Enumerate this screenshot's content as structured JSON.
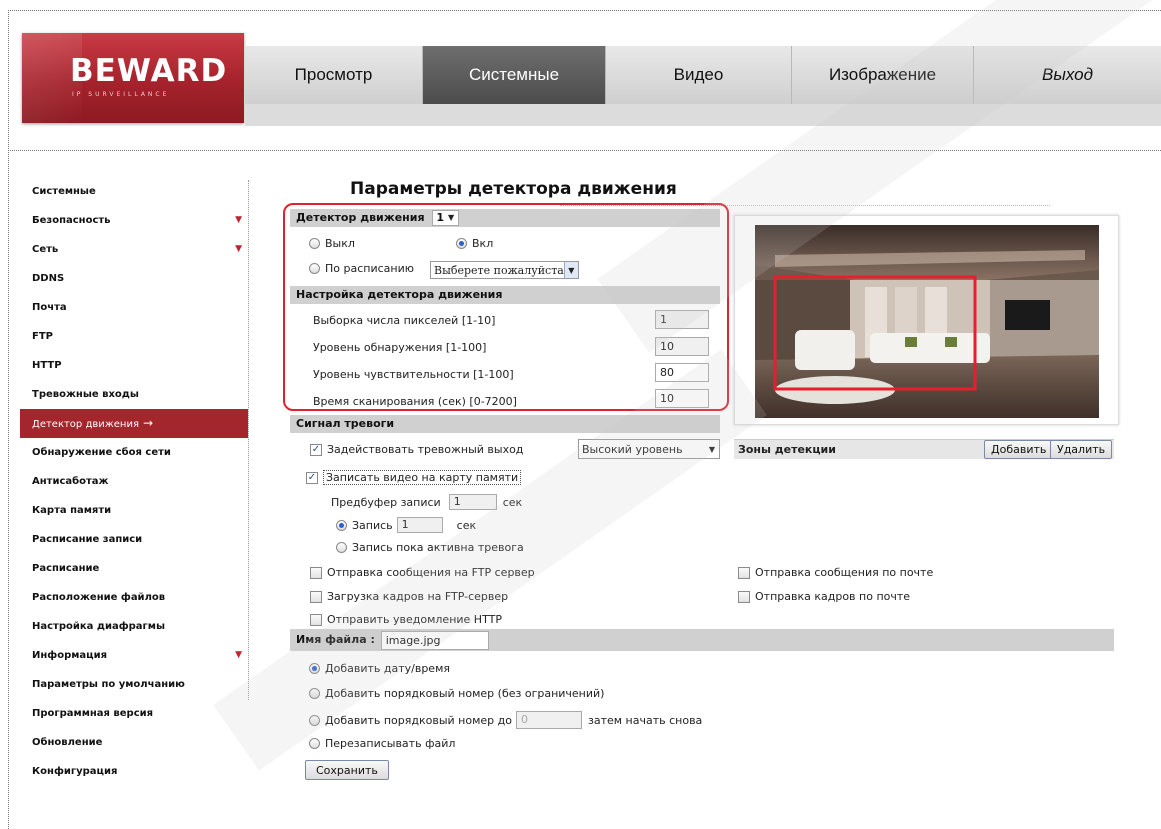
{
  "brand": {
    "logo_text": "BEWARD",
    "logo_sub": "IP SURVEILLANCE"
  },
  "nav": {
    "tabs": [
      "Просмотр",
      "Системные",
      "Видео",
      "Изображение",
      "Выход"
    ],
    "active": "Системные"
  },
  "sidebar": {
    "items": [
      {
        "label": "Системные"
      },
      {
        "label": "Безопасность",
        "arrow": "▼"
      },
      {
        "label": "Сеть",
        "arrow": "▼"
      },
      {
        "label": "DDNS"
      },
      {
        "label": "Почта"
      },
      {
        "label": "FTP"
      },
      {
        "label": "HTTP"
      },
      {
        "label": "Тревожные входы"
      },
      {
        "label": "Детектор движения",
        "arrow": "→",
        "active": true
      },
      {
        "label": "Обнаружение сбоя сети"
      },
      {
        "label": "Антисаботаж"
      },
      {
        "label": "Карта памяти"
      },
      {
        "label": "Расписание записи"
      },
      {
        "label": "Расписание"
      },
      {
        "label": "Расположение файлов"
      },
      {
        "label": "Настройка диафрагмы"
      },
      {
        "label": "Информация",
        "arrow": "▼"
      },
      {
        "label": "Параметры по умолчанию"
      },
      {
        "label": "Программная версия"
      },
      {
        "label": "Обновление"
      },
      {
        "label": "Конфигурация"
      }
    ]
  },
  "page": {
    "title": "Параметры детектора движения"
  },
  "motion": {
    "header": "Детектор движения",
    "channel": "1",
    "off_label": "Выкл",
    "on_label": "Вкл",
    "schedule_label": "По расписанию",
    "schedule_select": "Выберете пожалуйста"
  },
  "settings": {
    "header": "Настройка детектора движения",
    "rows": [
      {
        "label": "Выборка числа пикселей [1-10]",
        "value": "1"
      },
      {
        "label": "Уровень обнаружения [1-100]",
        "value": "10"
      },
      {
        "label": "Уровень чувствительности [1-100]",
        "value": "80"
      },
      {
        "label": "Время сканирования (сек) [0-7200]",
        "value": "10"
      }
    ]
  },
  "alarm": {
    "header": "Сигнал тревоги",
    "trigger_output": "Задействовать тревожный выход",
    "level_select": "Высокий уровень",
    "record_sd": "Записать видео на карту памяти",
    "prebuffer_label": "Предбуфер записи",
    "prebuffer_value": "1",
    "sec": "сек",
    "record_label": "Запись",
    "record_value": "1",
    "record_while_alarm": "Запись пока активна тревога",
    "ftp_message": "Отправка сообщения на FTP сервер",
    "ftp_upload": "Загрузка кадров на FTP-сервер",
    "http_notify": "Отправить уведомление HTTP",
    "mail_message": "Отправка сообщения по почте",
    "mail_frames": "Отправка кадров по почте"
  },
  "zones": {
    "label": "Зоны детекции",
    "add": "Добавить",
    "delete": "Удалить"
  },
  "filename": {
    "label": "Имя файла :",
    "value": "image.jpg",
    "opt_datetime": "Добавить дату/время",
    "opt_seq_unlimited": "Добавить порядковый номер (без ограничений)",
    "opt_seq_upto": "Добавить порядковый номер до",
    "seq_value": "0",
    "opt_seq_suffix": "затем начать снова",
    "opt_overwrite": "Перезаписывать файл"
  },
  "save_label": "Сохранить"
}
